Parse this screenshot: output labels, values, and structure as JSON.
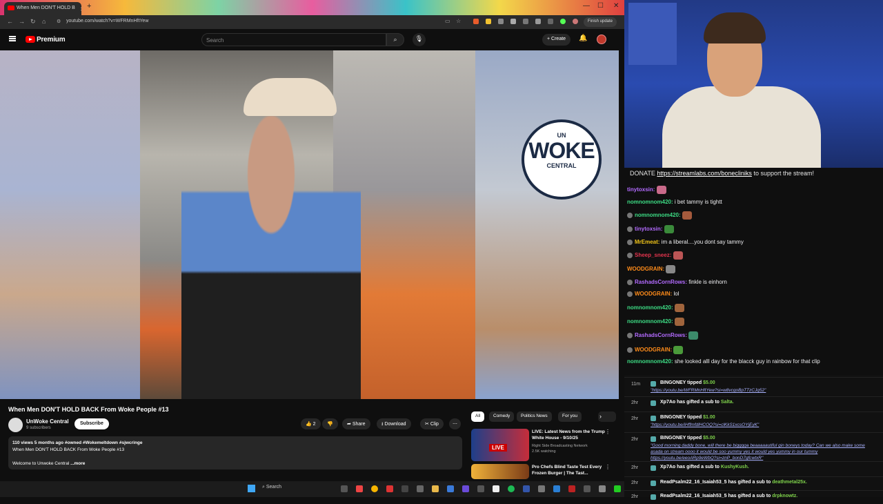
{
  "browser": {
    "tab_title": "When Men DON'T HOLD B",
    "url": "youtube.com/watch?v=WFRMnHftYew",
    "finish_update": "Finish update"
  },
  "youtube": {
    "logo_text": "Premium",
    "search_placeholder": "Search",
    "create_label": "Create",
    "video_title": "When Men DON'T HOLD BACK From Woke People #13",
    "channel_name": "UnWoke Central",
    "subscribers": "9 subscribers",
    "subscribe_label": "Subscribe",
    "like_count": "2",
    "share_label": "Share",
    "download_label": "Download",
    "clip_label": "Clip",
    "description_meta": "110 views  5 months ago  #owned #Wokemeltdown #sjwcringe",
    "description_line": "When Men DON'T HOLD BACK From Woke People #13",
    "description_welcome": "Welcome to Unwoke Central",
    "description_more": "...more",
    "chips": [
      "All",
      "Comedy",
      "Politics News",
      "For you"
    ],
    "recommended": [
      {
        "title": "LIVE: Latest News from the Trump White House - 9/10/25",
        "channel": "Right Side Broadcasting Network",
        "meta": "2.5K watching",
        "badge": "LIVE"
      },
      {
        "title": "Pro Chefs Blind Taste Test Every Frozen Burger | The Tast...",
        "channel": "",
        "meta": "",
        "badge": ""
      }
    ],
    "watermark": {
      "top": "UN",
      "main": "WOKE",
      "bottom": "CENTRAL"
    }
  },
  "taskbar": {
    "search": "Search"
  },
  "chat": {
    "donate_prefix": "DONATE",
    "donate_link": "https://streamlabs.com/bonecliniks",
    "donate_suffix": "to support the stream!",
    "messages": [
      {
        "user": "tinytoxsin:",
        "text": "",
        "color": "#b36bff"
      },
      {
        "user": "nomnomnom420:",
        "text": "i bet tammy is tightt",
        "color": "#3ddc84"
      },
      {
        "user": "nomnomnom420:",
        "text": "",
        "color": "#3ddc84"
      },
      {
        "user": "tinytoxsin:",
        "text": "",
        "color": "#b36bff"
      },
      {
        "user": "MrEmeat:",
        "text": "im a liberal....you dont say tammy",
        "color": "#f0c419"
      },
      {
        "user": "Sheep_sneez:",
        "text": "",
        "color": "#e2344d"
      },
      {
        "user": "WOODGRAIN:",
        "text": "",
        "color": "#ff8c1a"
      },
      {
        "user": "RashadsCornRows:",
        "text": "finkle is einhorn",
        "color": "#b36bff"
      },
      {
        "user": "WOODGRAIN:",
        "text": "lol",
        "color": "#ff8c1a"
      },
      {
        "user": "nomnomnom420:",
        "text": "",
        "color": "#3ddc84"
      },
      {
        "user": "nomnomnom420:",
        "text": "",
        "color": "#3ddc84"
      },
      {
        "user": "RashadsCornRows:",
        "text": "",
        "color": "#b36bff"
      },
      {
        "user": "WOODGRAIN:",
        "text": "",
        "color": "#ff8c1a"
      },
      {
        "user": "nomnomnom420:",
        "text": "she looked alll day for the blacck guy in rainbow for that clip",
        "color": "#3ddc84"
      }
    ]
  },
  "events": [
    {
      "time": "11m",
      "line": "BINGONEY tipped",
      "amount": "$5.00",
      "sub": "\"https://youtu.be/WFRMnHftYew?si=w8vcgoBpTTzCJq52\""
    },
    {
      "time": "2hr",
      "line": "Xp7Ao has gifted a sub to",
      "amount": "Salta.",
      "sub": ""
    },
    {
      "time": "2hr",
      "line": "BINGONEY tipped",
      "amount": "$1.00",
      "sub": "\"https://youtu.be/iHffmfdlHCOQ?si=clKkS1xcsOYjEyK\""
    },
    {
      "time": "2hr",
      "line": "BINGONEY tipped",
      "amount": "$5.00",
      "sub": "\"Good morning daddy bone, will there be bigggga beaaaaautiful gin boneys today? Can we also make some asada on stream oooo it would be soo yummy yes it would yes yummy in our tummy https://youtu.be/eeoARp9eWbQ?si=znP_bonD7gfcwtxR\""
    },
    {
      "time": "2hr",
      "line": "Xp7Ao has gifted a sub to",
      "amount": "KushyKush.",
      "sub": ""
    },
    {
      "time": "2hr",
      "line": "ReadPsalm22_16_Isaiah53_5 has gifted a sub to",
      "amount": "deathmetal25x.",
      "sub": ""
    },
    {
      "time": "2hr",
      "line": "ReadPsalm22_16_Isaiah53_5 has gifted a sub to",
      "amount": "drpknowtz.",
      "sub": ""
    }
  ]
}
